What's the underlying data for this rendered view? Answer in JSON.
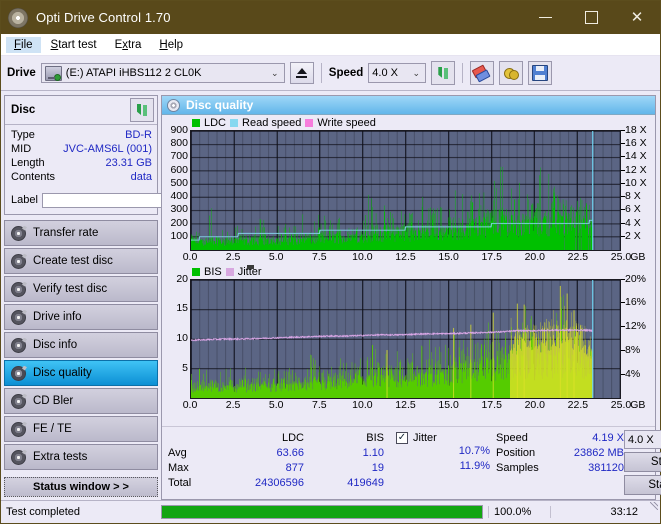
{
  "window": {
    "title": "Opti Drive Control 1.70",
    "icon": "disc-icon",
    "minimize": "—",
    "maximize": "□",
    "close": "✕",
    "titlebar_color": "#59491a"
  },
  "menu": {
    "items": [
      "File",
      "Start test",
      "Extra",
      "Help"
    ],
    "selected": "File"
  },
  "toolbar": {
    "drive_label": "Drive",
    "drive_value": "(E:)  ATAPI iHBS112  2 CL0K",
    "eject_label": "eject",
    "speed_label": "Speed",
    "speed_value": "4.0 X",
    "buttons": [
      "refresh-icon",
      "eraser-icon",
      "chemical-icon",
      "save-icon"
    ]
  },
  "sidebar": {
    "disc_panel": {
      "title": "Disc",
      "refresh_icon": "refresh-icon",
      "rows": [
        {
          "key": "Type",
          "value": "BD-R"
        },
        {
          "key": "MID",
          "value": "JVC-AMS6L (001)"
        },
        {
          "key": "Length",
          "value": "23.31 GB"
        },
        {
          "key": "Contents",
          "value": "data"
        }
      ],
      "label_key": "Label",
      "label_value": "",
      "label_placeholder": ""
    },
    "nav": [
      {
        "label": "Transfer rate",
        "active": false
      },
      {
        "label": "Create test disc",
        "active": false
      },
      {
        "label": "Verify test disc",
        "active": false
      },
      {
        "label": "Drive info",
        "active": false
      },
      {
        "label": "Disc info",
        "active": false
      },
      {
        "label": "Disc quality",
        "active": true
      },
      {
        "label": "CD Bler",
        "active": false
      },
      {
        "label": "FE / TE",
        "active": false
      },
      {
        "label": "Extra tests",
        "active": false
      }
    ],
    "status_window_button": "Status window > >"
  },
  "main": {
    "header": "Disc quality",
    "header_icon": "disc-quality-icon"
  },
  "stats": {
    "col_headers": [
      "LDC",
      "BIS"
    ],
    "rows": [
      {
        "label": "Avg",
        "ldc": "63.66",
        "bis": "1.10",
        "jitter": "10.7%"
      },
      {
        "label": "Max",
        "ldc": "877",
        "bis": "19",
        "jitter": "11.9%"
      },
      {
        "label": "Total",
        "ldc": "24306596",
        "bis": "419649",
        "jitter": ""
      }
    ],
    "jitter_label": "Jitter",
    "jitter_checked": true,
    "speed_label": "Speed",
    "speed_value": "4.19 X",
    "position_label": "Position",
    "position_value": "23862 MB",
    "samples_label": "Samples",
    "samples_value": "381120",
    "speed_select": "4.0 X",
    "start_full": "Start full",
    "start_part": "Start part"
  },
  "statusbar": {
    "message": "Test completed",
    "progress_percent": 100.0,
    "percent_text": "100.0%",
    "elapsed": "33:12"
  },
  "chart_data": [
    {
      "type": "area",
      "name": "ldc-chart",
      "title": "",
      "legend": [
        {
          "label": "LDC",
          "color": "#00c000"
        },
        {
          "label": "Read speed",
          "color": "#87d8f0"
        },
        {
          "label": "Write speed",
          "color": "#f77ddc"
        }
      ],
      "legend_position": "top-left",
      "xlabel": "GB",
      "xlim": [
        0.0,
        25.0
      ],
      "xticks": [
        0.0,
        2.5,
        5.0,
        7.5,
        10.0,
        12.5,
        15.0,
        17.5,
        20.0,
        22.5,
        25.0
      ],
      "xtick_labels": [
        "0.0",
        "2.5",
        "5.0",
        "7.5",
        "10.0",
        "12.5",
        "15.0",
        "17.5",
        "20.0",
        "22.5",
        "25.0"
      ],
      "ylabel": "",
      "ylim": [
        0,
        900
      ],
      "yticks": [
        100,
        200,
        300,
        400,
        500,
        600,
        700,
        800,
        900
      ],
      "ytick_labels": [
        "100",
        "200",
        "300",
        "400",
        "500",
        "600",
        "700",
        "800",
        "900"
      ],
      "y2lim": [
        0,
        18
      ],
      "y2ticks": [
        2,
        4,
        6,
        8,
        10,
        12,
        14,
        16,
        18
      ],
      "y2tick_labels": [
        "2 X",
        "4 X",
        "6 X",
        "8 X",
        "10 X",
        "12 X",
        "14 X",
        "16 X",
        "18 X"
      ],
      "grid": true,
      "plot_bg": "#5b6584",
      "data_end_gb": 23.4,
      "cursor_gb": 23.4,
      "series": [
        {
          "name": "LDC",
          "color": "#00c000",
          "type": "area-spikes",
          "x": [
            0.0,
            0.5,
            1.0,
            1.5,
            2.0,
            2.5,
            3.0,
            3.5,
            4.0,
            4.5,
            5.0,
            5.5,
            6.0,
            6.5,
            7.0,
            7.5,
            8.0,
            8.5,
            9.0,
            9.5,
            10.0,
            10.5,
            11.0,
            11.5,
            12.0,
            12.5,
            13.0,
            13.5,
            14.0,
            14.5,
            15.0,
            15.5,
            16.0,
            16.5,
            17.0,
            17.5,
            18.0,
            18.5,
            19.0,
            19.5,
            20.0,
            20.5,
            21.0,
            21.5,
            22.0,
            22.5,
            23.0,
            23.4
          ],
          "baseline": [
            95,
            90,
            85,
            85,
            90,
            90,
            95,
            95,
            95,
            100,
            100,
            100,
            105,
            105,
            110,
            115,
            125,
            130,
            135,
            140,
            150,
            155,
            160,
            165,
            170,
            175,
            180,
            185,
            190,
            195,
            200,
            205,
            230,
            250,
            255,
            260,
            265,
            270,
            275,
            280,
            285,
            290,
            300,
            310,
            320,
            330,
            310,
            270
          ],
          "peaks": [
            150,
            170,
            420,
            200,
            190,
            210,
            200,
            230,
            240,
            250,
            230,
            240,
            250,
            470,
            300,
            260,
            280,
            300,
            320,
            340,
            300,
            540,
            330,
            360,
            350,
            380,
            360,
            510,
            380,
            400,
            420,
            660,
            450,
            430,
            470,
            480,
            690,
            520,
            500,
            560,
            530,
            880,
            660,
            420
          ]
        },
        {
          "name": "Read speed",
          "color": "#87d8f0",
          "type": "line",
          "x": [
            0.0,
            1.0,
            2.0,
            3.0,
            4.0,
            5.0,
            6.0,
            7.0,
            8.0,
            9.0,
            10.0,
            11.0,
            12.0,
            13.0,
            14.0,
            15.0,
            16.0,
            17.0,
            18.0,
            19.0,
            20.0,
            21.0,
            22.0,
            23.0,
            23.4
          ],
          "values_x": [
            1.6,
            1.9,
            2.1,
            2.3,
            2.4,
            2.5,
            2.6,
            2.7,
            2.8,
            2.9,
            3.0,
            3.1,
            3.2,
            3.3,
            3.4,
            3.5,
            3.6,
            3.7,
            3.8,
            3.9,
            4.0,
            4.05,
            4.1,
            4.2,
            4.3
          ]
        },
        {
          "name": "Write speed",
          "color": "#f77ddc",
          "type": "line",
          "x": [],
          "values_x": []
        }
      ]
    },
    {
      "type": "area",
      "name": "bis-jitter-chart",
      "title": "",
      "legend": [
        {
          "label": "BIS",
          "color": "#00c000"
        },
        {
          "label": "Jitter",
          "color": "#d8a8e0"
        }
      ],
      "legend_position": "top-left",
      "xlabel": "GB",
      "xlim": [
        0.0,
        25.0
      ],
      "xticks": [
        0.0,
        2.5,
        5.0,
        7.5,
        10.0,
        12.5,
        15.0,
        17.5,
        20.0,
        22.5,
        25.0
      ],
      "xtick_labels": [
        "0.0",
        "2.5",
        "5.0",
        "7.5",
        "10.0",
        "12.5",
        "15.0",
        "17.5",
        "20.0",
        "22.5",
        "25.0"
      ],
      "ylim": [
        0,
        20
      ],
      "yticks": [
        5,
        10,
        15,
        20
      ],
      "ytick_labels": [
        "5",
        "10",
        "15",
        "20"
      ],
      "y2lim": [
        0,
        20
      ],
      "y2ticks": [
        4,
        8,
        12,
        16,
        20
      ],
      "y2tick_labels": [
        "4%",
        "8%",
        "12%",
        "16%",
        "20%"
      ],
      "grid": true,
      "plot_bg": "#5b6584",
      "data_end_gb": 23.4,
      "cursor_gb": 23.4,
      "series": [
        {
          "name": "BIS",
          "color": "#55cc00",
          "type": "area-spikes",
          "x": [
            0.0,
            0.5,
            1.0,
            1.5,
            2.0,
            2.5,
            3.0,
            3.5,
            4.0,
            4.5,
            5.0,
            5.5,
            6.0,
            6.5,
            7.0,
            7.5,
            8.0,
            8.5,
            9.0,
            9.5,
            10.0,
            10.5,
            11.0,
            11.5,
            12.0,
            12.5,
            13.0,
            13.5,
            14.0,
            14.5,
            15.0,
            15.5,
            16.0,
            16.5,
            17.0,
            17.5,
            18.0,
            18.5,
            19.0,
            19.5,
            20.0,
            20.5,
            21.0,
            21.5,
            22.0,
            22.5,
            23.0,
            23.4
          ],
          "baseline": [
            2.6,
            2.5,
            2.5,
            2.6,
            2.6,
            2.6,
            2.7,
            2.7,
            2.8,
            2.8,
            2.9,
            2.9,
            3.0,
            3.0,
            3.1,
            3.2,
            3.4,
            3.6,
            3.8,
            4.0,
            4.2,
            4.3,
            4.4,
            4.5,
            4.6,
            4.8,
            5.0,
            5.2,
            5.4,
            5.6,
            5.8,
            6.0,
            7.4,
            7.6,
            7.7,
            7.8,
            7.9,
            8.0,
            8.2,
            8.4,
            8.5,
            8.6,
            8.8,
            9.0,
            9.0,
            8.8,
            8.2,
            6.2
          ],
          "peaks": [
            5.0,
            5.4,
            5.2,
            8.9,
            5.0,
            5.2,
            5.4,
            5.0,
            5.3,
            5.6,
            5.2,
            5.8,
            5.4,
            5.6,
            8.0,
            5.5,
            6.6,
            6.8,
            7.0,
            7.2,
            7.4,
            12.1,
            7.8,
            8.2,
            8.6,
            9.0,
            9.4,
            13.0,
            10.0,
            10.4,
            13.2,
            11.0,
            14.0,
            11.4,
            11.8,
            15.0,
            12.4,
            12.8,
            16.0,
            15.8,
            13.6,
            14.0,
            14.4,
            19.0,
            17.4,
            13.2,
            12.0,
            9.0
          ]
        },
        {
          "name": "Jitter",
          "color": "#dca8e8",
          "type": "line",
          "x": [
            0.0,
            1.0,
            2.0,
            3.0,
            4.0,
            5.0,
            6.0,
            7.0,
            8.0,
            9.0,
            10.0,
            11.0,
            12.0,
            13.0,
            14.0,
            15.0,
            16.0,
            17.0,
            18.0,
            19.0,
            20.0,
            21.0,
            22.0,
            23.0,
            23.4
          ],
          "values_pct": [
            9.8,
            9.9,
            10.0,
            10.0,
            10.1,
            10.2,
            10.3,
            10.4,
            10.5,
            10.5,
            10.6,
            10.7,
            10.7,
            10.8,
            10.9,
            10.9,
            11.0,
            11.1,
            11.2,
            11.4,
            11.4,
            11.5,
            11.5,
            11.5,
            11.4
          ]
        }
      ]
    }
  ]
}
